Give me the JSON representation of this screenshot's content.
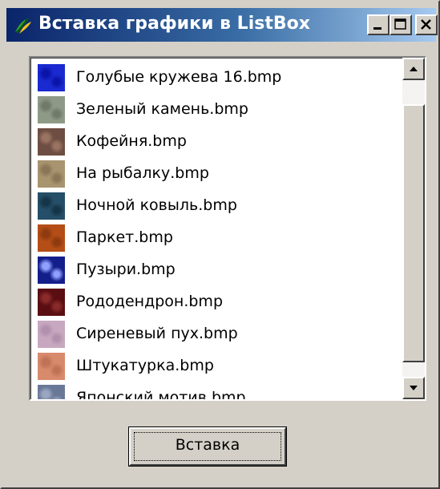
{
  "window": {
    "title": "Вставка графики в ListBox",
    "icon": "app-leaf-icon"
  },
  "titlebar_buttons": {
    "minimize": "minimize-icon",
    "maximize": "maximize-icon",
    "close": "close-icon"
  },
  "listbox": {
    "items": [
      {
        "label": "Голубые кружева 16.bmp",
        "color": "#1a2ad0",
        "accent": "#0a14a8"
      },
      {
        "label": "Зеленый камень.bmp",
        "color": "#8e9a86",
        "accent": "#6f7a68"
      },
      {
        "label": "Кофейня.bmp",
        "color": "#6e4d42",
        "accent": "#9a7463"
      },
      {
        "label": "На рыбалку.bmp",
        "color": "#a8946e",
        "accent": "#8a7656"
      },
      {
        "label": "Ночной ковыль.bmp",
        "color": "#254e68",
        "accent": "#143548"
      },
      {
        "label": "Паркет.bmp",
        "color": "#b44e16",
        "accent": "#8e3a10"
      },
      {
        "label": "Пузыри.bmp",
        "color": "#141e8a",
        "accent": "#8fa0ff"
      },
      {
        "label": "Рододендрон.bmp",
        "color": "#5a0e12",
        "accent": "#8a2a2a"
      },
      {
        "label": "Сиреневый пух.bmp",
        "color": "#c8a8c0",
        "accent": "#b090ac"
      },
      {
        "label": "Штукатурка.bmp",
        "color": "#d88a6c",
        "accent": "#c07256"
      },
      {
        "label": "Японский мотив.bmp",
        "color": "#6a7898",
        "accent": "#9aa6c0"
      }
    ],
    "scroll_up": "scroll-up-arrow-icon",
    "scroll_down": "scroll-down-arrow-icon"
  },
  "insert_button": {
    "label": "Вставка"
  }
}
